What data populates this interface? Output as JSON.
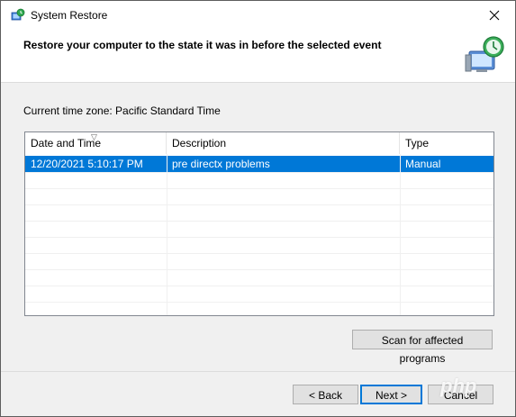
{
  "window": {
    "title": "System Restore"
  },
  "header": {
    "title": "Restore your computer to the state it was in before the selected event"
  },
  "timezone": {
    "label": "Current time zone: Pacific Standard Time"
  },
  "table": {
    "columns": [
      "Date and Time",
      "Description",
      "Type"
    ],
    "rows": [
      {
        "date": "12/20/2021 5:10:17 PM",
        "description": "pre directx problems",
        "type": "Manual",
        "selected": true
      }
    ]
  },
  "buttons": {
    "scan": "Scan for affected programs",
    "back": "< Back",
    "next": "Next >",
    "cancel": "Cancel"
  },
  "watermark": "php",
  "colors": {
    "selection": "#0078d7",
    "default_border": "#0078d7"
  },
  "icons": [
    "system-restore-icon",
    "close-icon",
    "computer-restore-icon",
    "sort-arrow-icon"
  ]
}
